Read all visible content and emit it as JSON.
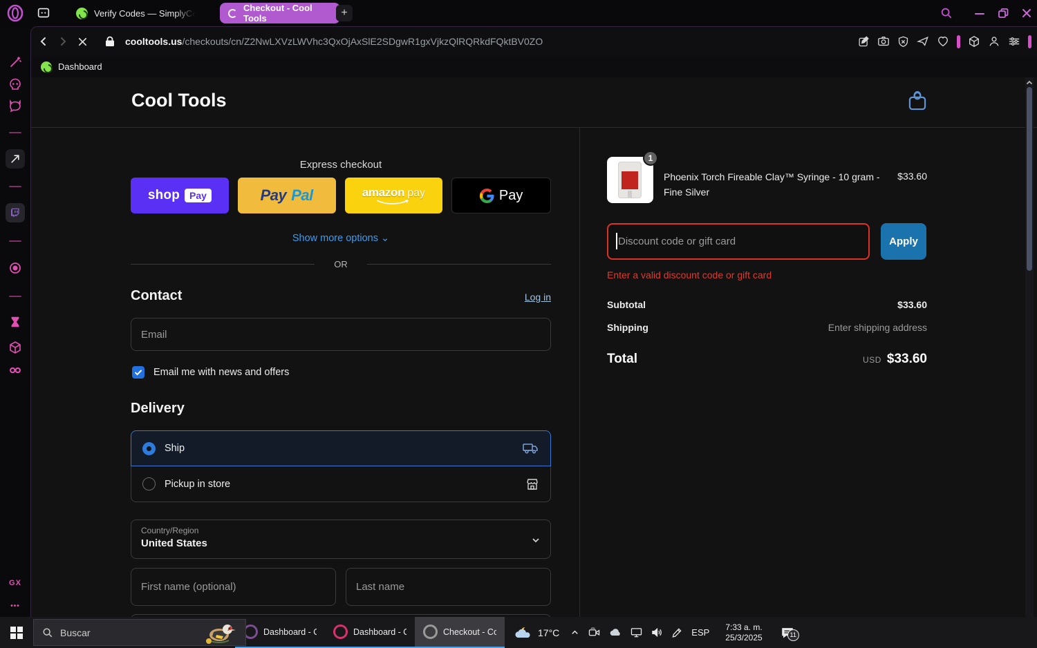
{
  "browser": {
    "tabs": [
      {
        "label": "Verify Codes — SimplyCo",
        "active": false
      },
      {
        "label": "Checkout - Cool Tools",
        "active": true
      }
    ],
    "new_tab_label": "+",
    "url_host": "cooltools.us",
    "url_path": "/checkouts/cn/Z2NwLXVzLWVhc3QxOjAxSlE2SDgwR1gxVjkzQlRQRkdFQktBV0ZO",
    "bookmark_label": "Dashboard"
  },
  "sidebar": {
    "gx_label": "GX",
    "more_label": "•••"
  },
  "page": {
    "store_name": "Cool Tools",
    "express": {
      "title": "Express checkout",
      "shop_word": "shop",
      "shop_pay": "Pay",
      "paypal_pay": "Pay",
      "paypal_pal": "Pal",
      "amazon_word": "amazon",
      "amazon_pay": "pay",
      "gpay_pay": "Pay",
      "more_options": "Show more options",
      "or": "OR"
    },
    "contact": {
      "title": "Contact",
      "login": "Log in",
      "email_placeholder": "Email",
      "newsletter": "Email me with news and offers"
    },
    "delivery": {
      "title": "Delivery",
      "ship": "Ship",
      "pickup": "Pickup in store",
      "country_label": "Country/Region",
      "country_value": "United States",
      "first_name_placeholder": "First name (optional)",
      "last_name_placeholder": "Last name"
    },
    "summary": {
      "qty_badge": "1",
      "item_title": "Phoenix Torch Fireable Clay™ Syringe - 10 gram - Fine Silver",
      "item_price": "$33.60",
      "discount_placeholder": "Discount code or gift card",
      "apply_label": "Apply",
      "error": "Enter a valid discount code or gift card",
      "subtotal_label": "Subtotal",
      "subtotal_value": "$33.60",
      "shipping_label": "Shipping",
      "shipping_value": "Enter shipping address",
      "total_label": "Total",
      "currency": "USD",
      "total_value": "$33.60"
    }
  },
  "taskbar": {
    "search_placeholder": "Buscar",
    "windows": [
      {
        "title": "Dashboard - O...",
        "active": false
      },
      {
        "title": "Dashboard - O...",
        "active": false
      },
      {
        "title": "Checkout - Co...",
        "active": true
      }
    ],
    "weather_temp": "17°C",
    "tray_lang": "ESP",
    "tray_time": "7:33 a. m.",
    "tray_date": "25/3/2025",
    "notification_count": "11"
  },
  "colors": {
    "accent_magenta": "#d64fc8",
    "sidebar_icon": "#e24fb4",
    "active_tab": "#b159cf",
    "link_blue": "#3e9bef",
    "selected_blue": "#2d7bdc",
    "apply_blue": "#1a73ad",
    "error_red": "#de3226",
    "shop_pay_purple": "#5a31f4",
    "paypal_yellow": "#f1bb3e",
    "amazon_yellow": "#fbd20e"
  }
}
